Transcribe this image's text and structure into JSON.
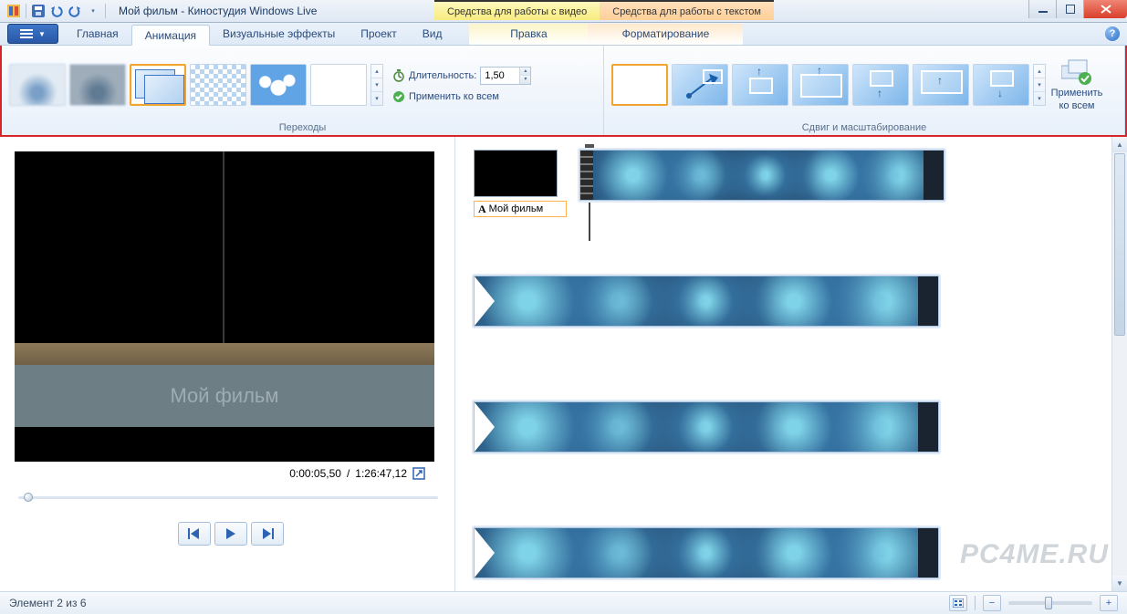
{
  "titlebar": {
    "title": "Мой фильм - Киностудия Windows Live",
    "context_tabs": {
      "video": "Средства для работы с видео",
      "text": "Средства для работы с текстом"
    }
  },
  "ribbon_tabs": {
    "home": "Главная",
    "animation": "Анимация",
    "visual_effects": "Визуальные эффекты",
    "project": "Проект",
    "view": "Вид",
    "edit": "Правка",
    "format": "Форматирование"
  },
  "ribbon": {
    "transitions_group": "Переходы",
    "panzoom_group": "Сдвиг и масштабирование",
    "duration_label": "Длительность:",
    "duration_value": "1,50",
    "apply_all": "Применить ко всем",
    "apply_all_btn_line1": "Применить",
    "apply_all_btn_line2": "ко всем"
  },
  "preview": {
    "overlay_title": "Мой фильм",
    "current_time": "0:00:05,50",
    "total_time": "1:26:47,12"
  },
  "timeline": {
    "text_chip": "Мой фильм"
  },
  "statusbar": {
    "item_status": "Элемент 2 из 6"
  },
  "watermark": "PC4ME.RU"
}
